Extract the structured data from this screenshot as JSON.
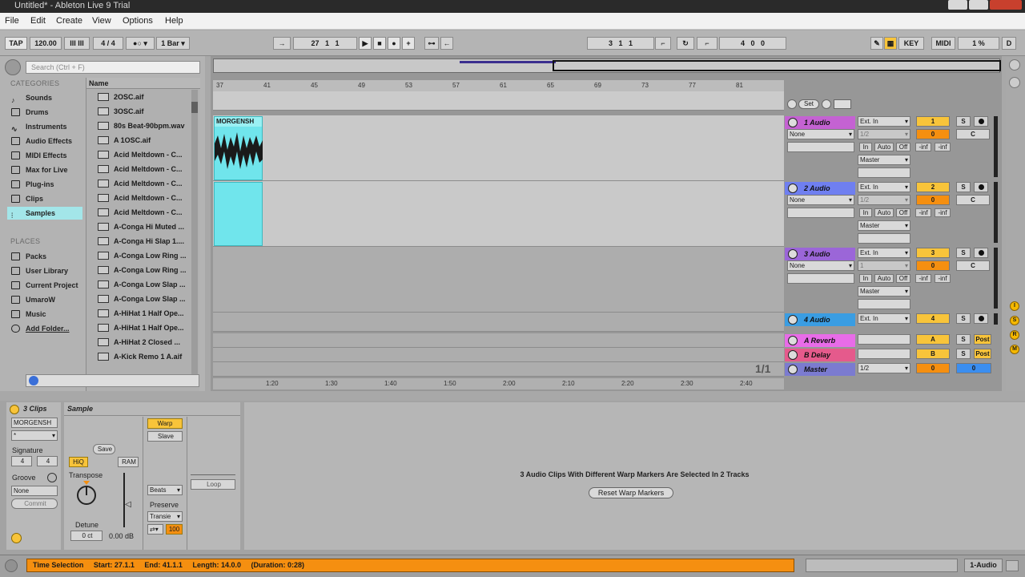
{
  "window": {
    "title": "Untitled* - Ableton Live 9 Trial"
  },
  "menu": [
    "File",
    "Edit",
    "Create",
    "View",
    "Options",
    "Help"
  ],
  "control": {
    "tap": "TAP",
    "tempo": "120.00",
    "metro_marks": "III III",
    "sig_num": "4",
    "sig_slash": "/",
    "sig_den": "4",
    "metronome": "1 Bar",
    "arr_pos": [
      "27",
      "1",
      "1"
    ],
    "loop_start": [
      "3",
      "1",
      "1"
    ],
    "loop_len": [
      "4",
      "0",
      "0"
    ],
    "key": "KEY",
    "midi": "MIDI",
    "cpu": "1 %",
    "d": "D"
  },
  "browser": {
    "search_placeholder": "Search (Ctrl + F)",
    "categories_title": "CATEGORIES",
    "categories": [
      "Sounds",
      "Drums",
      "Instruments",
      "Audio Effects",
      "MIDI Effects",
      "Max for Live",
      "Plug-ins",
      "Clips",
      "Samples"
    ],
    "selected_category": "Samples",
    "places_title": "PLACES",
    "places": [
      "Packs",
      "User Library",
      "Current Project",
      "UmaroW",
      "Music",
      "Add Folder..."
    ],
    "name_header": "Name",
    "files": [
      "2OSC.aif",
      "3OSC.aif",
      "80s Beat-90bpm.wav",
      "A 1OSC.aif",
      "Acid Meltdown - C...",
      "Acid Meltdown - C...",
      "Acid Meltdown - C...",
      "Acid Meltdown - C...",
      "Acid Meltdown - C...",
      "A-Conga Hi Muted ...",
      "A-Conga Hi Slap 1....",
      "A-Conga Low Ring ...",
      "A-Conga Low Ring ...",
      "A-Conga Low Slap ...",
      "A-Conga Low Slap ...",
      "A-HiHat 1 Half Ope...",
      "A-HiHat 1 Half Ope...",
      "A-HiHat 2 Closed ...",
      "A-Kick Remo 1 A.aif"
    ]
  },
  "arrangement": {
    "ruler": [
      "37",
      "41",
      "45",
      "49",
      "53",
      "57",
      "61",
      "65",
      "69",
      "73",
      "77",
      "81"
    ],
    "time_ruler": [
      "1:20",
      "1:30",
      "1:40",
      "1:50",
      "2:00",
      "2:10",
      "2:20",
      "2:30",
      "2:40"
    ],
    "set_label": "Set",
    "zoom_label": "1/1",
    "clip_name": "MORGENSH",
    "tracks": [
      {
        "name": "1 Audio",
        "color": "#c462d2",
        "input": "Ext. In",
        "channel": "1/2",
        "monitor": [
          "In",
          "Auto",
          "Off"
        ],
        "output": "Master",
        "num": "1",
        "send": "0",
        "pan": "C",
        "vol": "-inf",
        "peak": "-inf",
        "clip_none": "None"
      },
      {
        "name": "2 Audio",
        "color": "#6f7ff0",
        "input": "Ext. In",
        "channel": "1/2",
        "monitor": [
          "In",
          "Auto",
          "Off"
        ],
        "output": "Master",
        "num": "2",
        "send": "0",
        "pan": "C",
        "vol": "-inf",
        "peak": "-inf",
        "clip_none": "None"
      },
      {
        "name": "3 Audio",
        "color": "#9b66d8",
        "input": "Ext. In",
        "channel": "1",
        "monitor": [
          "In",
          "Auto",
          "Off"
        ],
        "output": "Master",
        "num": "3",
        "send": "0",
        "pan": "C",
        "vol": "-inf",
        "peak": "-inf",
        "clip_none": "None"
      },
      {
        "name": "4 Audio",
        "color": "#3a9de2",
        "input": "Ext. In",
        "num": "4"
      }
    ],
    "returns": [
      {
        "name": "A Reverb",
        "color": "#e86ce8",
        "num": "A",
        "post": "Post"
      },
      {
        "name": "B Delay",
        "color": "#e55a8c",
        "num": "B",
        "post": "Post"
      }
    ],
    "master": {
      "name": "Master",
      "color": "#7b7bd0",
      "channel": "1/2",
      "send": "0",
      "vol": "0"
    },
    "solo": "S"
  },
  "detail": {
    "clip_title": "3 Clips",
    "clip_name": "MORGENSH",
    "clip_select": "*",
    "signature_label": "Signature",
    "sig_num": "4",
    "sig_den": "4",
    "groove_label": "Groove",
    "groove_value": "None",
    "commit": "Commit",
    "sample_title": "Sample",
    "save": "Save",
    "hiq": "HiQ",
    "ram": "RAM",
    "transpose_label": "Transpose",
    "detune_label": "Detune",
    "detune_value": "0 ct",
    "gain_value": "0.00 dB",
    "warp": "Warp",
    "slave": "Slave",
    "beats": "Beats",
    "preserve_label": "Preserve",
    "preserve_value": "Transie",
    "env_value": "100",
    "loop": "Loop",
    "message": "3 Audio Clips With Different Warp Markers Are Selected In 2 Tracks",
    "reset_button": "Reset Warp Markers"
  },
  "status": {
    "label": "Time Selection",
    "start": "Start: 27.1.1",
    "end": "End: 41.1.1",
    "length": "Length: 14.0.0",
    "duration": "(Duration: 0:28)",
    "track": "1-Audio"
  }
}
